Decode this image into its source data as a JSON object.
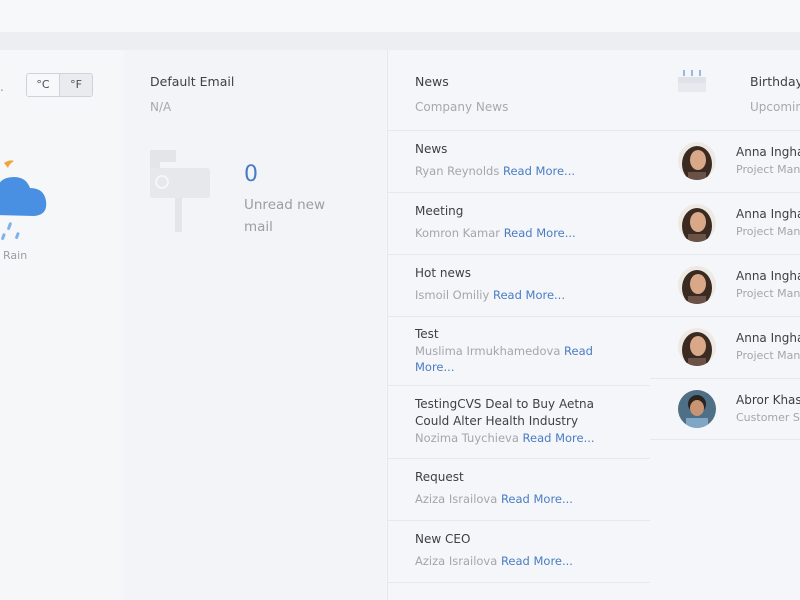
{
  "weather": {
    "temp_suffix": ".",
    "units": [
      "°C",
      "°F"
    ],
    "condition": "Rain",
    "icon": "rain-cloud-icon"
  },
  "email": {
    "title": "Default Email",
    "subtitle": "N/A",
    "unread_count": "0",
    "unread_label": "Unread new mail",
    "icon": "mailbox-icon"
  },
  "news": {
    "title": "News",
    "subtitle": "Company News",
    "read_more": "Read More...",
    "items": [
      {
        "title": "News",
        "author": "Ryan Reynolds"
      },
      {
        "title": "Meeting",
        "author": "Komron Kamar"
      },
      {
        "title": "Hot news",
        "author": "Ismoil Omiliy"
      },
      {
        "title": "Test",
        "author": "Muslima Irmukhamedova"
      },
      {
        "title": "TestingCVS Deal to Buy Aetna Could Alter Health Industry",
        "author": "Nozima Tuychieva"
      },
      {
        "title": "Request",
        "author": "Aziza Israilova"
      },
      {
        "title": "New CEO",
        "author": "Aziza Israilova"
      }
    ]
  },
  "birthdays": {
    "title": "Birthday",
    "subtitle": "Upcomin",
    "icon": "cake-icon",
    "people": [
      {
        "name": "Anna Ingha",
        "role": "Project Mana"
      },
      {
        "name": "Anna Ingha",
        "role": "Project Mana"
      },
      {
        "name": "Anna Ingha",
        "role": "Project Mana"
      },
      {
        "name": "Anna Ingha",
        "role": "Project Mana"
      },
      {
        "name": "Abror Khas",
        "role": "Customer Su"
      }
    ]
  }
}
